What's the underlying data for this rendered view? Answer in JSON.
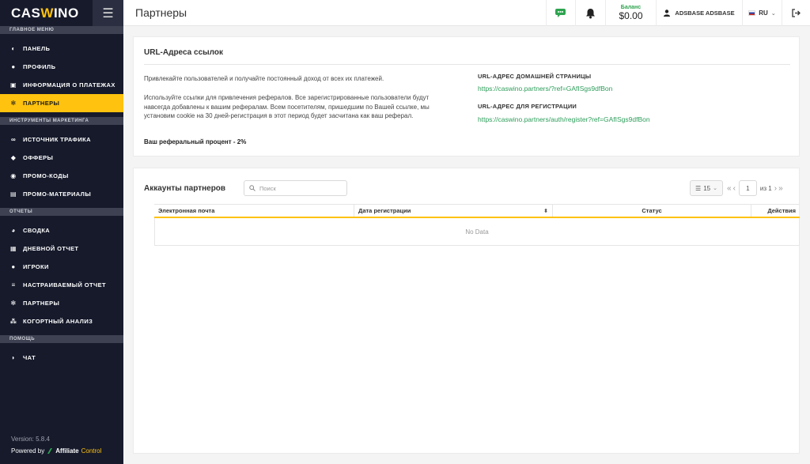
{
  "app": {
    "logo_pre": "CAS",
    "logo_accent": "W",
    "logo_post": "INO",
    "page_title": "Партнеры"
  },
  "topbar": {
    "balance_label": "Баланс",
    "balance_value": "$0.00",
    "user_name": "ADSBASE ADSBASE",
    "language": "RU"
  },
  "sidebar": {
    "sections": [
      {
        "title": "ГЛАВНОЕ МЕНЮ",
        "items": [
          {
            "label": "ПАНЕЛЬ",
            "icon": "dashboard-icon",
            "glyph": "◐",
            "active": false
          },
          {
            "label": "ПРОФИЛЬ",
            "icon": "user-icon",
            "glyph": "●",
            "active": false
          },
          {
            "label": "ИНФОРМАЦИЯ О ПЛАТЕЖАХ",
            "icon": "payment-icon",
            "glyph": "▣",
            "active": false
          },
          {
            "label": "ПАРТНЕРЫ",
            "icon": "users-icon",
            "glyph": "✻",
            "active": true
          }
        ]
      },
      {
        "title": "ИНСТРУМЕНТЫ МАРКЕТИНГА",
        "items": [
          {
            "label": "ИСТОЧНИК ТРАФИКА",
            "icon": "link-icon",
            "glyph": "∞",
            "active": false
          },
          {
            "label": "ОФФЕРЫ",
            "icon": "tag-icon",
            "glyph": "◆",
            "active": false
          },
          {
            "label": "ПРОМО-КОДЫ",
            "icon": "promo-code-icon",
            "glyph": "◉",
            "active": false
          },
          {
            "label": "ПРОМО-МАТЕРИАЛЫ",
            "icon": "image-icon",
            "glyph": "▤",
            "active": false
          }
        ]
      },
      {
        "title": "ОТЧЕТЫ",
        "items": [
          {
            "label": "СВОДКА",
            "icon": "summary-icon",
            "glyph": "◕",
            "active": false
          },
          {
            "label": "ДНЕВНОЙ ОТЧЕТ",
            "icon": "calendar-icon",
            "glyph": "▦",
            "active": false
          },
          {
            "label": "ИГРОКИ",
            "icon": "player-icon",
            "glyph": "●",
            "active": false
          },
          {
            "label": "НАСТРАИВАЕМЫЙ ОТЧЕТ",
            "icon": "sliders-icon",
            "glyph": "≡",
            "active": false
          },
          {
            "label": "ПАРТНЕРЫ",
            "icon": "partners-icon",
            "glyph": "✻",
            "active": false
          },
          {
            "label": "КОГОРТНЫЙ АНАЛИЗ",
            "icon": "cohort-icon",
            "glyph": "⁂",
            "active": false
          }
        ]
      },
      {
        "title": "ПОМОЩЬ",
        "items": [
          {
            "label": "ЧАТ",
            "icon": "chat-icon",
            "glyph": "◗",
            "active": false
          }
        ]
      }
    ],
    "version": "Version: 5.8.4",
    "powered_by": "Powered by",
    "powered_brand": "Affiliate",
    "powered_brand2": "Control"
  },
  "urls_card": {
    "title": "URL-Адреса ссылок",
    "intro": "Привлекайте пользователей и получайте постоянный доход от всех их платежей.",
    "description": "Используйте ссылки для привлечения рефералов. Все зарегистрированные пользователи будут навсегда добавлены к вашим рефералам. Всем посетителям, пришедшим по Вашей ссылке, мы установим cookie на 30 дней-регистрация в этот период будет засчитана как ваш реферал.",
    "percent": "Ваш реферальный процент - 2%",
    "home_label": "URL-АДРЕС ДОМАШНЕЙ СТРАНИЦЫ",
    "home_url": "https://caswino.partners/?ref=GAfISgs9dfBon",
    "reg_label": "URL-АДРЕС ДЛЯ РЕГИСТРАЦИИ",
    "reg_url": "https://caswino.partners/auth/register?ref=GAfISgs9dfBon"
  },
  "accounts_card": {
    "title": "Аккаунты партнеров",
    "search_placeholder": "Поиск",
    "page_size": "15",
    "page": "1",
    "page_total": "из 1",
    "columns": [
      "Электронная почта",
      "Дата регистрации",
      "Статус",
      "Действия"
    ],
    "empty_text": "No Data"
  },
  "colors": {
    "accent": "#ffc20e",
    "sidebar_bg": "#161a2b",
    "link": "#2e9e5b",
    "success": "#2ea44f"
  }
}
